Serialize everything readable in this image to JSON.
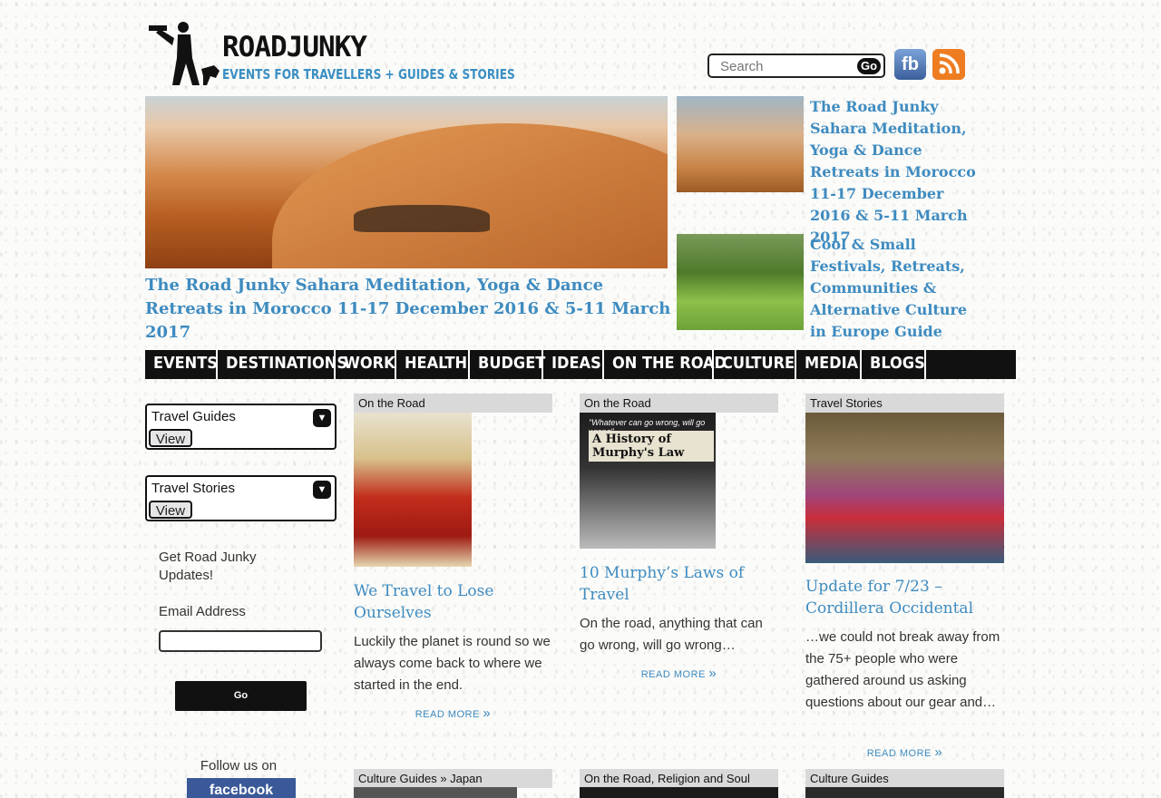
{
  "header": {
    "logo_title": "ROADJUNKY",
    "logo_tagline": "EVENTS FOR TRAVELLERS + GUIDES & STORIES",
    "search_placeholder": "Search",
    "search_button": "Go",
    "facebook_label": "fb"
  },
  "hero": {
    "caption": "The Road Junky Sahara Meditation, Yoga & Dance Retreats in Morocco 11-17 December 2016 & 5-11 March 2017"
  },
  "featured": [
    {
      "title": "The Road Junky Sahara Meditation, Yoga & Dance Retreats in Morocco 11-17 December 2016 & 5-11 March 2017"
    },
    {
      "title": "Cool & Small Festivals, Retreats, Communities & Alternative Culture in Europe Guide"
    }
  ],
  "nav": [
    "EVENTS",
    "DESTINATIONS",
    "WORK",
    "HEALTH",
    "BUDGET",
    "IDEAS",
    "ON THE ROAD",
    "CULTURE",
    "MEDIA",
    "BLOGS"
  ],
  "sidebar": {
    "dropdowns": [
      {
        "label": "Travel Guides",
        "button": "View"
      },
      {
        "label": "Travel Stories",
        "button": "View"
      }
    ],
    "updates_heading": "Get Road Junky Updates!",
    "email_label": "Email Address",
    "go_button": "Go",
    "follow_text": "Follow us on",
    "facebook_badge": "facebook"
  },
  "articles": [
    {
      "category": "On the Road",
      "title": "We Travel to Lose Ourselves",
      "excerpt": "Luckily the planet is round so we always come back to where we started in the end.",
      "read_more": "read more"
    },
    {
      "category": "On the Road",
      "image_caption": "\"Whatever can go wrong, will go wrong\"",
      "image_title": "A History of Murphy's Law",
      "title": "10 Murphy’s Laws of Travel",
      "excerpt": "On the road, anything that can go wrong, will go wrong…",
      "read_more": "read more"
    },
    {
      "category": "Travel Stories",
      "title": "Update for 7/23 – Cordillera Occidental",
      "excerpt": "…we could not break away from the 75+ people who were gathered around us asking questions about our gear and…",
      "read_more": "read more"
    }
  ],
  "bottom_categories": [
    "Culture Guides » Japan",
    "On the Road, Religion and Soul",
    "Culture Guides"
  ],
  "colors": {
    "link": "#3e8bc0",
    "nav_bg": "#111111",
    "category_bg": "#d9d9d9"
  }
}
